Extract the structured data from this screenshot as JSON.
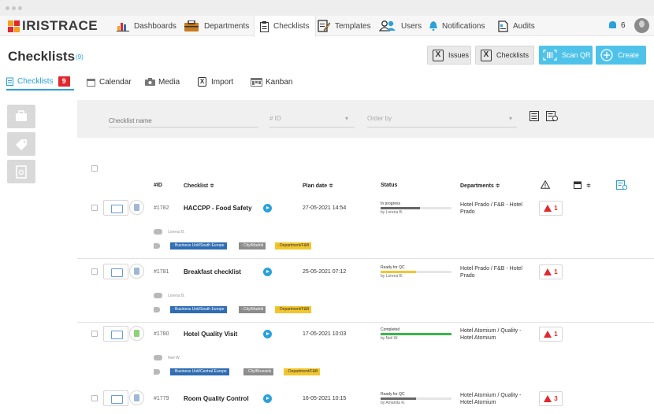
{
  "app": {
    "brand": "IRISTRACE"
  },
  "nav": [
    {
      "label": "Dashboards",
      "icon": "bar-chart-icon"
    },
    {
      "label": "Departments",
      "icon": "briefcase-icon"
    },
    {
      "label": "Checklists",
      "icon": "clipboard-icon",
      "active": true
    },
    {
      "label": "Templates",
      "icon": "edit-doc-icon"
    },
    {
      "label": "Users",
      "icon": "users-icon"
    },
    {
      "label": "Notifications",
      "icon": "bell-icon"
    },
    {
      "label": "Audits",
      "icon": "document-icon"
    }
  ],
  "notif_count": "6",
  "page": {
    "title": "Checklists",
    "count": "(9)"
  },
  "header_buttons": {
    "issues": "Issues",
    "checklists": "Checklists",
    "scan": "Scan QR",
    "create": "Create"
  },
  "tabs": [
    {
      "label": "Checklists",
      "badge": "9",
      "active": true
    },
    {
      "label": "Calendar"
    },
    {
      "label": "Media"
    },
    {
      "label": "Import"
    },
    {
      "label": "Kanban"
    }
  ],
  "filters": {
    "name_placeholder": "Checklist name",
    "id_placeholder": "# ID",
    "order_placeholder": "Order by"
  },
  "columns": {
    "id": "#ID",
    "checklist": "Checklist ≑",
    "plan_date": "Plan date ≑",
    "status": "Status",
    "departments": "Departments ≑",
    "calendar_sort": "≑"
  },
  "rows": [
    {
      "id": "#1782",
      "name": "HACCPP - Food Safety",
      "date": "27-05-2021 14:54",
      "status": "In progress",
      "status_by": "by Lorena B.",
      "progress": 0.55,
      "bar_color": "#666666",
      "dept": "Hotel Prado / F&B - Hotel Prado",
      "issues": "1",
      "responsible": "Lorena B.",
      "tags": [
        "- Business Unit/South Europe",
        "- City/Madrid",
        "- Department/F&B"
      ]
    },
    {
      "id": "#1781",
      "name": "Breakfast checklist",
      "date": "25-05-2021 07:12",
      "status": "Ready for QC",
      "status_by": "by Lorena B.",
      "progress": 0.5,
      "bar_color": "#f2c62e",
      "dept": "Hotel Prado / F&B - Hotel Prado",
      "issues": "1",
      "responsible": "Lorena B.",
      "tags": [
        "- Business Unit/South Europe",
        "- City/Madrid",
        "- Department/F&B"
      ]
    },
    {
      "id": "#1780",
      "name": "Hotel Quality Visit",
      "date": "17-05-2021 10:03",
      "status": "Completed",
      "status_by": "by Neil W.",
      "progress": 1.0,
      "bar_color": "#3cb54a",
      "dept": "Hotel Atomium / Quality - Hotel Atomium",
      "issues": "1",
      "responsible": "Neil W.",
      "tags": [
        "- Business Unit/Central Europe",
        "- City/Brussels",
        "- Department/F&B"
      ]
    },
    {
      "id": "#1779",
      "name": "Room Quality Control",
      "date": "16-05-2021 10:15",
      "status": "Ready for QC",
      "status_by": "by Amanda R.",
      "progress": 0.5,
      "bar_color": "#666666",
      "dept": "Hotel Atomium / Quality - Hotel Atomium",
      "issues": "3",
      "responsible": "",
      "tags": []
    }
  ]
}
